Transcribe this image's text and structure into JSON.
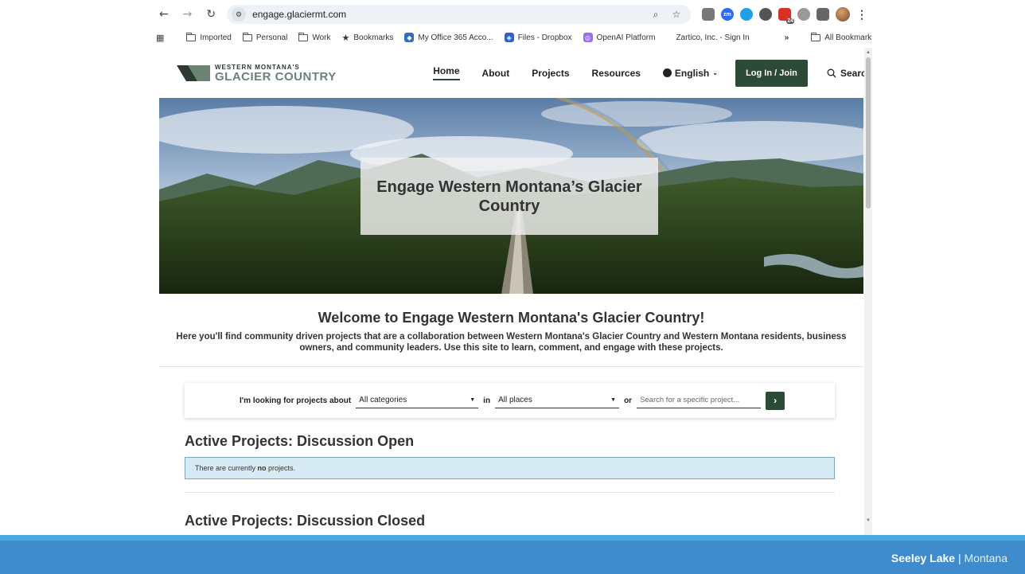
{
  "browser": {
    "url": "engage.glaciermt.com",
    "site_info_icon": "tune-icon",
    "extension_badge": "24",
    "bookmarks": {
      "items": [
        {
          "label": "Imported",
          "icon": "folder-icon"
        },
        {
          "label": "Personal",
          "icon": "folder-icon"
        },
        {
          "label": "Work",
          "icon": "folder-icon"
        },
        {
          "label": "Bookmarks",
          "icon": "star-icon"
        },
        {
          "label": "My Office 365 Acco...",
          "icon": "office-icon"
        },
        {
          "label": "Files - Dropbox",
          "icon": "dropbox-icon"
        },
        {
          "label": "OpenAI Platform",
          "icon": "openai-icon"
        },
        {
          "label": "Zartico, Inc. - Sign In",
          "icon": "none"
        }
      ],
      "overflow": "»",
      "all_bookmarks": "All Bookmarks"
    }
  },
  "site": {
    "logo": {
      "line1": "WESTERN MONTANA'S",
      "line2": "GLACIER COUNTRY"
    },
    "nav": {
      "home": "Home",
      "about": "About",
      "projects": "Projects",
      "resources": "Resources",
      "language": "English",
      "login": "Log In / Join",
      "search": "Search"
    },
    "hero": {
      "title": "Engage Western Montana’s Glacier Country"
    },
    "welcome": {
      "title": "Welcome to Engage Western Montana's Glacier Country!",
      "body": "Here you'll find community driven projects that are a collaboration between Western Montana's Glacier Country and Western Montana residents, business owners, and community leaders. Use this site to learn, comment, and engage with these projects."
    },
    "filter": {
      "label": "I'm looking for projects about",
      "category_value": "All categories",
      "in_label": "in",
      "place_value": "All places",
      "or_label": "or",
      "search_placeholder": "Search for a specific project...",
      "go": "›"
    },
    "sections": {
      "open_title": "Active Projects: Discussion Open",
      "no_projects_prefix": "There are currently ",
      "no_projects_bold": "no",
      "no_projects_suffix": " projects.",
      "closed_title": "Active Projects: Discussion Closed"
    }
  },
  "footer": {
    "place": "Seeley Lake",
    "separator": " | ",
    "state": "Montana"
  },
  "colors": {
    "brand_green": "#2d4a37",
    "footer_blue": "#3e8ccb",
    "alert_bg": "#d7ebf5"
  }
}
